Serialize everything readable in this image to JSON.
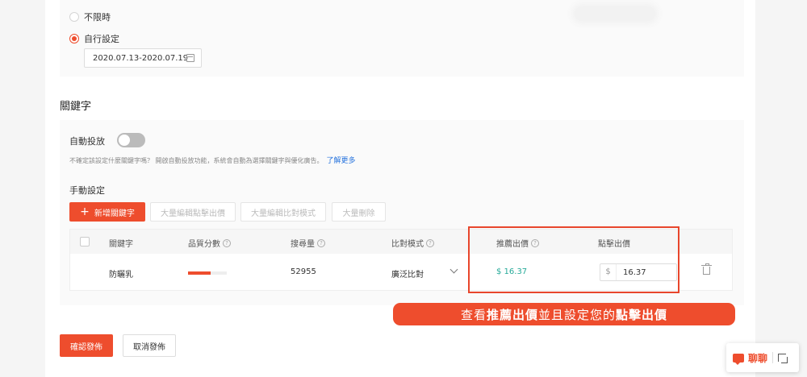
{
  "schedule": {
    "option_unlimited": "不限時",
    "option_custom": "自行設定",
    "date_range": "2020.07.13-2020.07.19"
  },
  "keywords": {
    "section_title": "關鍵字",
    "auto_label": "自動投放",
    "hint": "不確定該設定什麼關鍵字嗎？ 開啟自動投放功能，系統會自動為選擇關鍵字與優化廣告。",
    "hint_link": "了解更多",
    "manual_label": "手動設定",
    "add_button": "新增關鍵字",
    "bulk_bid_button": "大量編輯點擊出價",
    "bulk_match_button": "大量編輯比對模式",
    "bulk_delete_button": "大量刪除"
  },
  "table": {
    "headers": {
      "keyword": "關鍵字",
      "quality": "品質分數",
      "search_volume": "搜尋量",
      "match_type": "比對模式",
      "recommended_bid": "推薦出價",
      "bid": "點擊出價"
    },
    "rows": [
      {
        "keyword": "防曬乳",
        "quality_score_fraction": 0.58,
        "search_volume": "52955",
        "match_type": "廣泛比對",
        "recommended_bid": "$ 16.37",
        "currency": "$",
        "bid": "16.37"
      }
    ]
  },
  "annotation": {
    "prefix": "查看",
    "bold1": "推薦出價",
    "middle": "並且設定您的",
    "bold2": "點擊出價"
  },
  "footer": {
    "confirm": "確認發佈",
    "cancel": "取消發佈"
  },
  "chat": {
    "label": "聊聊"
  },
  "colors": {
    "accent": "#ee4d2d",
    "recommended": "#26aa99",
    "link": "#2673dd"
  }
}
